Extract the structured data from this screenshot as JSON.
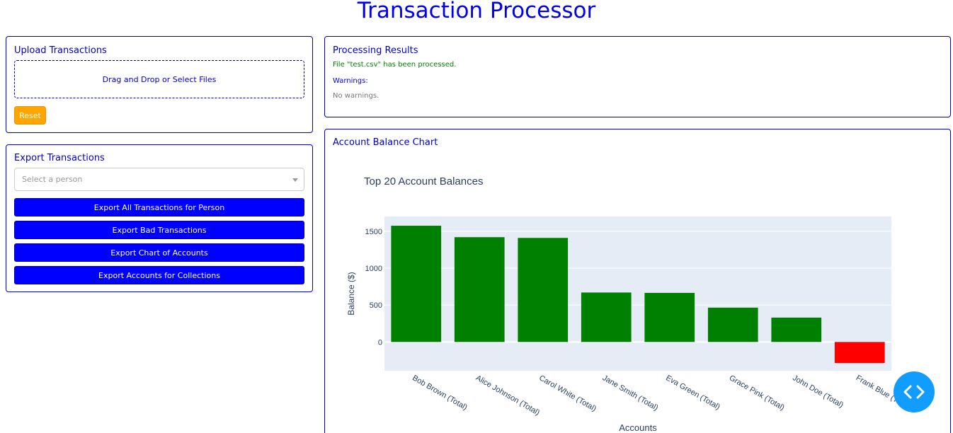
{
  "header": {
    "title": "Transaction Processor"
  },
  "upload": {
    "title": "Upload Transactions",
    "dropzone_text": "Drag and Drop or Select Files",
    "reset_label": "Reset"
  },
  "export": {
    "title": "Export Transactions",
    "select_placeholder": "Select a person",
    "buttons": [
      {
        "label": "Export All Transactions for Person"
      },
      {
        "label": "Export Bad Transactions"
      },
      {
        "label": "Export Chart of Accounts"
      },
      {
        "label": "Export Accounts for Collections"
      }
    ]
  },
  "results": {
    "title": "Processing Results",
    "message": "File \"test.csv\" has been processed.",
    "warnings_heading": "Warnings:",
    "warnings_text": "No warnings."
  },
  "chart_panel": {
    "title": "Account Balance Chart"
  },
  "chart_data": {
    "type": "bar",
    "title": "Top 20 Account Balances",
    "xlabel": "Accounts",
    "ylabel": "Balance ($)",
    "categories": [
      "Bob Brown (Total)",
      "Alice Johnson (Total)",
      "Carol White (Total)",
      "Jane Smith (Total)",
      "Eva Green (Total)",
      "Grace Pink (Total)",
      "John Doe (Total)",
      "Frank Blue (Total)"
    ],
    "values": [
      1575,
      1420,
      1410,
      670,
      665,
      465,
      330,
      -285
    ],
    "colors": [
      "#008000",
      "#008000",
      "#008000",
      "#008000",
      "#008000",
      "#008000",
      "#008000",
      "#ff0000"
    ],
    "yticks": [
      0,
      500,
      1000,
      1500
    ],
    "ylim": [
      -390,
      1700
    ],
    "grid": true,
    "plot_bg": "#e5ecf6"
  },
  "colors": {
    "accent": "#0000ff",
    "warning_button": "#ffa500",
    "success_text": "#008000",
    "fab": "#119dff"
  },
  "fab": {
    "icon": "code-icon"
  }
}
